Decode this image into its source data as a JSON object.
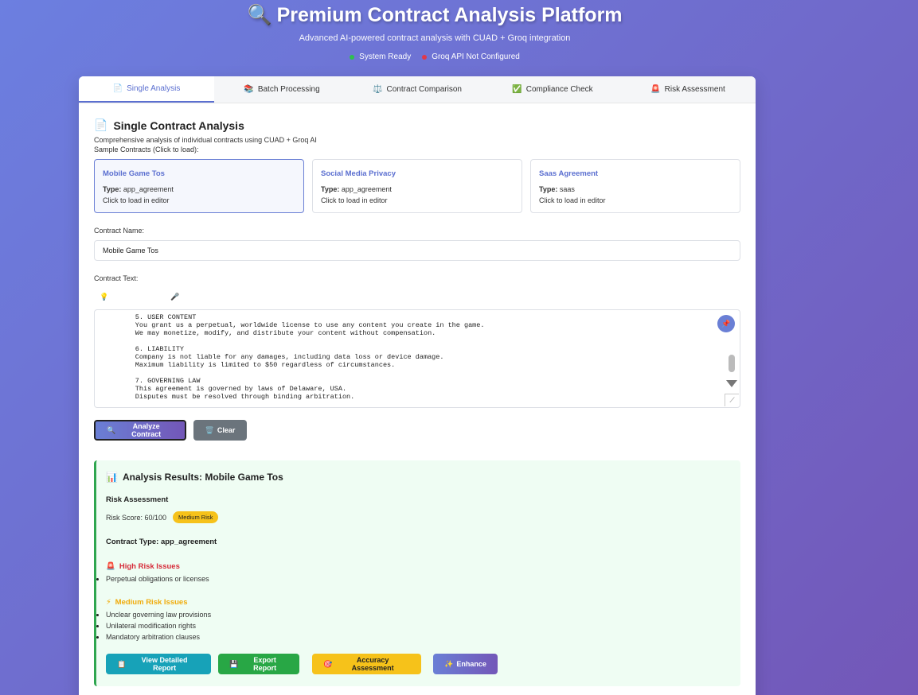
{
  "header": {
    "title_icon": "magnifier-icon",
    "title_icon_glyph": "🔍",
    "title": "Premium Contract Analysis Platform",
    "subtitle": "Advanced AI-powered contract analysis with CUAD + Groq integration",
    "status": [
      {
        "label": "System Ready",
        "color": "#2fbf4f"
      },
      {
        "label": "Groq API Not Configured",
        "color": "#e0394a"
      }
    ]
  },
  "tabs": [
    {
      "glyph": "📄",
      "label": "Single Analysis",
      "active": true
    },
    {
      "glyph": "📚",
      "label": "Batch Processing"
    },
    {
      "glyph": "⚖️",
      "label": "Contract Comparison"
    },
    {
      "glyph": "✅",
      "label": "Compliance Check"
    },
    {
      "glyph": "🚨",
      "label": "Risk Assessment"
    }
  ],
  "single": {
    "title_glyph": "📄",
    "title": "Single Contract Analysis",
    "description": "Comprehensive analysis of individual contracts using CUAD + Groq AI",
    "samples_label": "Sample Contracts (Click to load):",
    "samples": [
      {
        "title": "Mobile Game Tos",
        "type_label": "Type:",
        "type": "app_agreement",
        "hint": "Click to load in editor"
      },
      {
        "title": "Social Media Privacy",
        "type_label": "Type:",
        "type": "app_agreement",
        "hint": "Click to load in editor"
      },
      {
        "title": "Saas Agreement",
        "type_label": "Type:",
        "type": "saas",
        "hint": "Click to load in editor"
      }
    ],
    "name_label": "Contract Name:",
    "name_value": "Mobile Game Tos",
    "text_label": "Contract Text:",
    "tool_glyphs": [
      "💡",
      "🎤"
    ],
    "contract_text": "        5. USER CONTENT\n        You grant us a perpetual, worldwide license to use any content you create in the game.\n        We may monetize, modify, and distribute your content without compensation.\n\n        6. LIABILITY\n        Company is not liable for any damages, including data loss or device damage.\n        Maximum liability is limited to $50 regardless of circumstances.\n\n        7. GOVERNING LAW\n        This agreement is governed by laws of Delaware, USA.\n        Disputes must be resolved through binding arbitration.",
    "pin_glyph": "📌",
    "analyze_glyph": "🔍",
    "analyze_label": "Analyze Contract",
    "clear_glyph": "🗑️",
    "clear_label": "Clear"
  },
  "results": {
    "title_glyph": "📊",
    "title": "Analysis Results: Mobile Game Tos",
    "risk_heading": "Risk Assessment",
    "risk_score": "Risk Score: 60/100",
    "risk_badge": "Medium Risk",
    "contract_type": "Contract Type: app_agreement",
    "high_glyph": "🚨",
    "high_title": "High Risk Issues",
    "high_items": [
      "Perpetual obligations or licenses"
    ],
    "med_glyph": "⚡",
    "med_title": "Medium Risk Issues",
    "med_items": [
      "Unclear governing law provisions",
      "Unilateral modification rights",
      "Mandatory arbitration clauses"
    ],
    "buttons": [
      {
        "glyph": "📋",
        "label": "View Detailed Report"
      },
      {
        "glyph": "💾",
        "label": "Export Report"
      },
      {
        "glyph": "🎯",
        "label": "Accuracy Assessment"
      },
      {
        "glyph": "✨",
        "label": "Enhance"
      }
    ]
  }
}
